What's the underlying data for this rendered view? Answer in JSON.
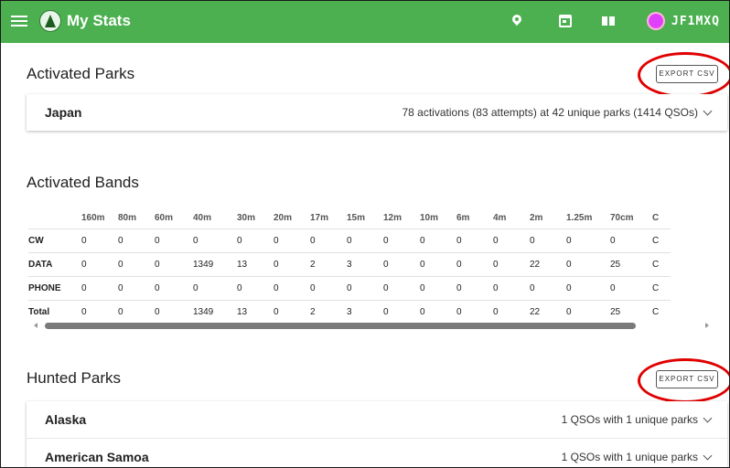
{
  "appbar": {
    "title": "My Stats",
    "callsign": "JF1MXQ",
    "icons": [
      "menu-icon",
      "app-logo",
      "map-pin-icon",
      "calendar-icon",
      "book-icon",
      "avatar"
    ]
  },
  "activated_parks": {
    "title": "Activated Parks",
    "export_label": "EXPORT CSV",
    "rows": [
      {
        "name": "Japan",
        "summary": "78 activations (83 attempts) at 42 unique parks (1414 QSOs)"
      }
    ]
  },
  "activated_bands": {
    "title": "Activated Bands",
    "columns": [
      "",
      "160m",
      "80m",
      "60m",
      "40m",
      "30m",
      "20m",
      "17m",
      "15m",
      "12m",
      "10m",
      "6m",
      "4m",
      "2m",
      "1.25m",
      "70cm",
      "C"
    ],
    "rows": [
      [
        "CW",
        "0",
        "0",
        "0",
        "0",
        "0",
        "0",
        "0",
        "0",
        "0",
        "0",
        "0",
        "0",
        "0",
        "0",
        "0",
        "C"
      ],
      [
        "DATA",
        "0",
        "0",
        "0",
        "1349",
        "13",
        "0",
        "2",
        "3",
        "0",
        "0",
        "0",
        "0",
        "22",
        "0",
        "25",
        "C"
      ],
      [
        "PHONE",
        "0",
        "0",
        "0",
        "0",
        "0",
        "0",
        "0",
        "0",
        "0",
        "0",
        "0",
        "0",
        "0",
        "0",
        "0",
        "C"
      ],
      [
        "Total",
        "0",
        "0",
        "0",
        "1349",
        "13",
        "0",
        "2",
        "3",
        "0",
        "0",
        "0",
        "0",
        "22",
        "0",
        "25",
        "C"
      ]
    ]
  },
  "hunted_parks": {
    "title": "Hunted Parks",
    "export_label": "EXPORT CSV",
    "rows": [
      {
        "name": "Alaska",
        "summary": "1 QSOs with 1 unique parks"
      },
      {
        "name": "American Samoa",
        "summary": "1 QSOs with 1 unique parks"
      }
    ]
  },
  "colors": {
    "appbar": "#4caf50",
    "highlight": "#e00000"
  }
}
